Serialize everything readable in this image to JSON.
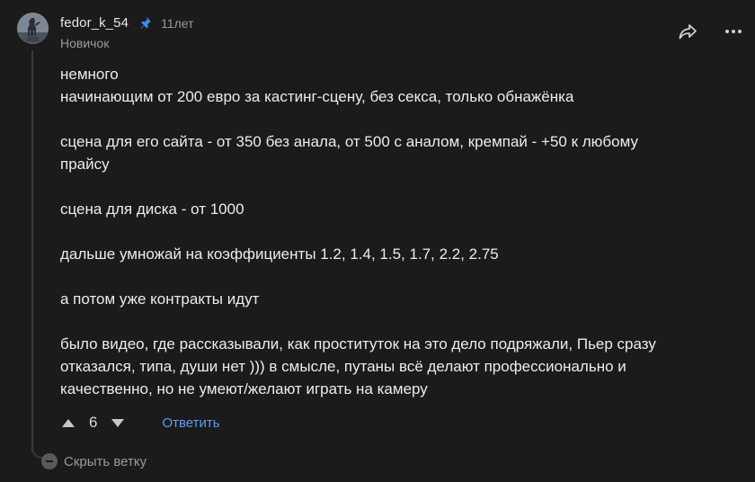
{
  "comment": {
    "author": "fedor_k_54",
    "age": "11лет",
    "rank": "Новичок",
    "paragraphs": [
      [
        "немного",
        "начинающим от 200 евро за кастинг-сцену, без секса, только обнажёнка"
      ],
      [
        "сцена для его сайта - от 350 без анала, от 500 с аналом, кремпай - +50 к любому",
        "прайсу"
      ],
      [
        "сцена для диска - от 1000"
      ],
      [
        "дальше умножай на коэффициенты 1.2, 1.4, 1.5, 1.7, 2.2, 2.75"
      ],
      [
        "а потом уже контракты идут"
      ],
      [
        "было видео, где рассказывали, как проституток на это дело подряжали, Пьер сразу",
        "отказался, типа, души нет ))) в смысле, путаны всё делают профессионально и",
        "качественно, но не умеют/желают играть на камеру"
      ]
    ]
  },
  "actions": {
    "vote_count": "6",
    "reply_label": "Ответить",
    "collapse_label": "Скрыть ветку"
  },
  "icons": {
    "pin": "pin-icon",
    "share": "share-icon",
    "more": "more-icon",
    "upvote": "upvote-icon",
    "downvote": "downvote-icon",
    "collapse": "minus-circle-icon"
  },
  "colors": {
    "background": "#1b1b1b",
    "text": "#ececec",
    "muted": "#9a9a9a",
    "link": "#5b9cf0",
    "pin": "#3d8bf0"
  }
}
